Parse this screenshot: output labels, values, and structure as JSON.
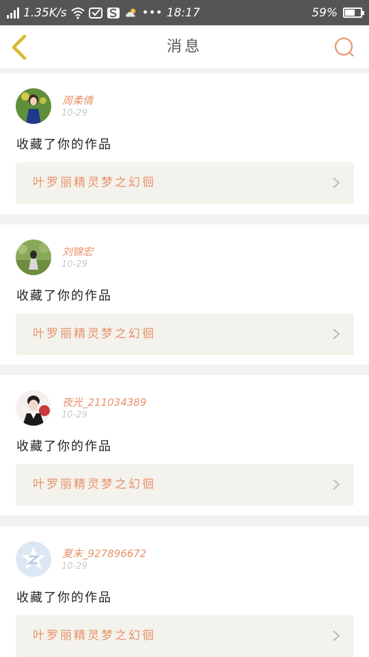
{
  "status_bar": {
    "network_speed": "1.35K/s",
    "time": "18:17",
    "battery_percent": "59%",
    "battery_level": 0.59,
    "icons": [
      "signal-icon",
      "wifi-icon",
      "message-icon",
      "s-app-icon",
      "weather-icon",
      "more-icon",
      "battery-icon"
    ]
  },
  "header": {
    "title": "消息",
    "back_icon": "chevron-left-icon",
    "search_icon": "search-icon"
  },
  "colors": {
    "accent": "#e8926a",
    "back_icon": "#e8c53a",
    "card_bg": "#ffffff",
    "work_bg": "#f3f2ec",
    "page_bg": "#f2f2f2"
  },
  "messages": [
    {
      "username": "周柔倩",
      "date": "10-29",
      "action": "收藏了你的作品",
      "work_title": "叶罗丽精灵梦之幻徊"
    },
    {
      "username": "刘锦宏",
      "date": "10-29",
      "action": "收藏了你的作品",
      "work_title": "叶罗丽精灵梦之幻徊"
    },
    {
      "username": "夜光_211034389",
      "date": "10-29",
      "action": "收藏了你的作品",
      "work_title": "叶罗丽精灵梦之幻徊"
    },
    {
      "username": "夏末_927896672",
      "date": "10-29",
      "action": "收藏了你的作品",
      "work_title": "叶罗丽精灵梦之幻徊"
    }
  ]
}
